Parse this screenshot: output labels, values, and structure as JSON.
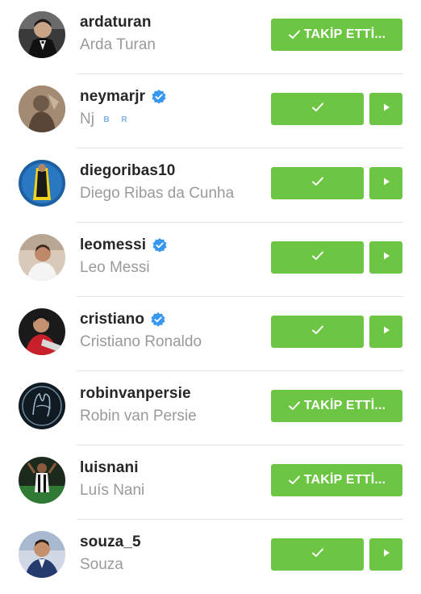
{
  "colors": {
    "follow_green": "#6cc644",
    "username": "#262626",
    "fullname": "#9a9a9a",
    "verified_blue": "#3897f0"
  },
  "accounts": [
    {
      "username": "ardaturan",
      "full_name": "Arda Turan",
      "verified": false,
      "button_label": "TAKİP ETTİ...",
      "button_style": "label"
    },
    {
      "username": "neymarjr",
      "full_name": "Nj",
      "name_emoji": [
        "B",
        "R"
      ],
      "verified": true,
      "button_style": "check-with-arrow"
    },
    {
      "username": "diegoribas10",
      "full_name": "Diego Ribas da Cunha",
      "verified": false,
      "button_style": "check-with-arrow"
    },
    {
      "username": "leomessi",
      "full_name": "Leo Messi",
      "verified": true,
      "button_style": "check-with-arrow"
    },
    {
      "username": "cristiano",
      "full_name": "Cristiano Ronaldo",
      "verified": true,
      "button_style": "check-with-arrow"
    },
    {
      "username": "robinvanpersie",
      "full_name": "Robin van Persie",
      "verified": false,
      "button_label": "TAKİP ETTİ...",
      "button_style": "label"
    },
    {
      "username": "luisnani",
      "full_name": "Luís Nani",
      "verified": false,
      "button_label": "TAKİP ETTİ...",
      "button_style": "label"
    },
    {
      "username": "souza_5",
      "full_name": "Souza",
      "verified": false,
      "button_style": "check-with-arrow"
    }
  ],
  "icons": {
    "follow_check": "checkmark-icon",
    "more": "play-arrow-icon",
    "verified": "verified-badge-icon"
  }
}
